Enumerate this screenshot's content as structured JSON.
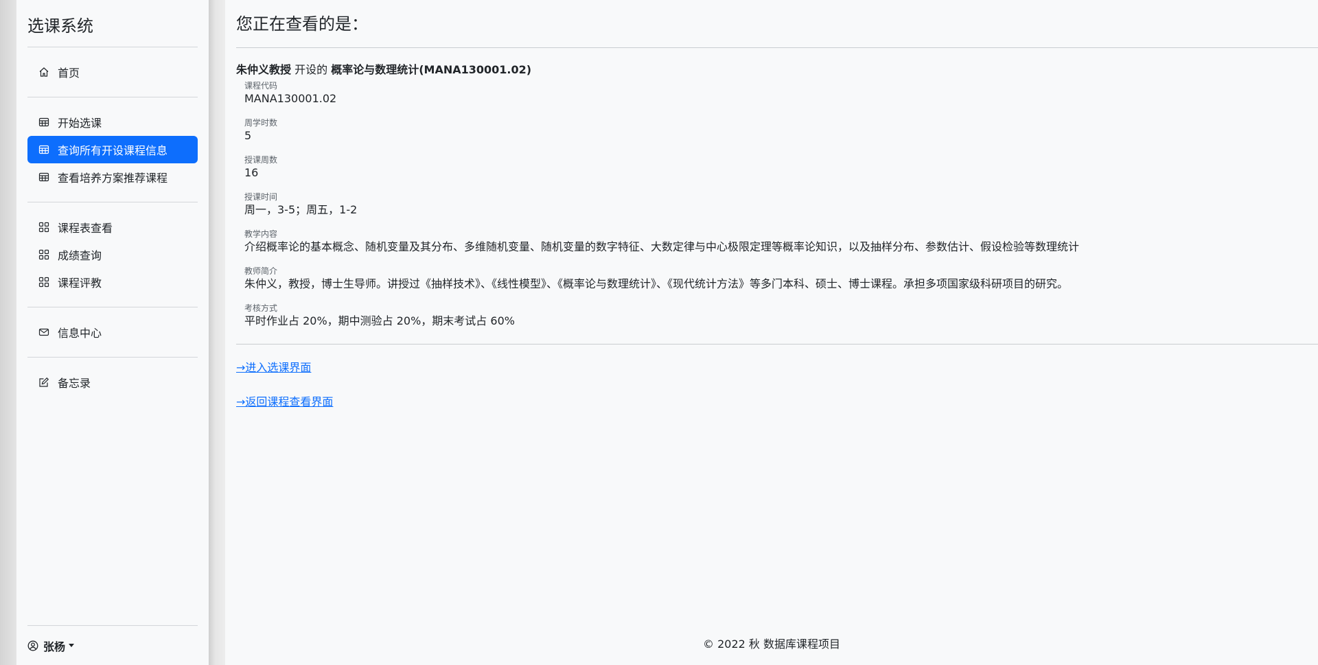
{
  "sidebar": {
    "brand": "选课系统",
    "groups": [
      [
        {
          "label": "首页",
          "icon": "home-icon"
        }
      ],
      [
        {
          "label": "开始选课",
          "icon": "table-icon"
        },
        {
          "label": "查询所有开设课程信息",
          "icon": "table-icon",
          "active": true
        },
        {
          "label": "查看培养方案推荐课程",
          "icon": "table-icon"
        }
      ],
      [
        {
          "label": "课程表查看",
          "icon": "grid-icon"
        },
        {
          "label": "成绩查询",
          "icon": "grid-icon"
        },
        {
          "label": "课程评教",
          "icon": "grid-icon"
        }
      ],
      [
        {
          "label": "信息中心",
          "icon": "envelope-icon"
        }
      ],
      [
        {
          "label": "备忘录",
          "icon": "pencil-square-icon"
        }
      ]
    ],
    "user": "张杨"
  },
  "main": {
    "title": "您正在查看的是：",
    "teacher": "朱仲义教授",
    "offer_text": "开设的",
    "course": "概率论与数理统计(MANA130001.02)",
    "fields": [
      {
        "label": "课程代码",
        "value": "MANA130001.02"
      },
      {
        "label": "周学时数",
        "value": "5"
      },
      {
        "label": "授课周数",
        "value": "16"
      },
      {
        "label": "授课时间",
        "value": "周一，3-5；周五，1-2"
      },
      {
        "label": "教学内容",
        "value": "介绍概率论的基本概念、随机变量及其分布、多维随机变量、随机变量的数字特征、大数定律与中心极限定理等概率论知识，以及抽样分布、参数估计、假设检验等数理统计"
      },
      {
        "label": "教师简介",
        "value": "朱仲义，教授，博士生导师。讲授过《抽样技术》、《线性模型》、《概率论与数理统计》、《现代统计方法》等多门本科、硕士、博士课程。承担多项国家级科研项目的研究。"
      },
      {
        "label": "考核方式",
        "value": "平时作业占 20%，期中测验占 20%，期末考试占 60%"
      }
    ],
    "link_enter": "→进入选课界面",
    "link_back": "→返回课程查看界面"
  },
  "footer": "© 2022 秋 数据库课程项目"
}
